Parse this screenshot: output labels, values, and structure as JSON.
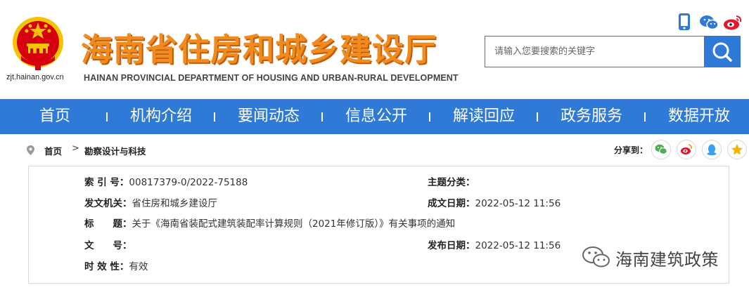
{
  "header": {
    "domain": "zjt.hainan.gov.cn",
    "title": "海南省住房和城乡建设厅",
    "subtitle": "HAINAN PROVINCIAL DEPARTMENT OF HOUSING AND URBAN-RURAL DEVELOPMENT",
    "search": {
      "placeholder": "请输入您要搜索的关键字"
    },
    "icons": [
      "mobile-icon",
      "wechat-icon",
      "weibo-icon"
    ]
  },
  "nav": {
    "items": [
      {
        "label": "首页"
      },
      {
        "label": "机构介绍"
      },
      {
        "label": "要闻动态"
      },
      {
        "label": "信息公开"
      },
      {
        "label": "解读回应"
      },
      {
        "label": "政务服务"
      },
      {
        "label": "数据开放"
      }
    ]
  },
  "breadcrumb": {
    "home": "首页",
    "separator": ">",
    "current": "勘察设计与科技",
    "share_label": "分享到：",
    "share_icons": [
      "wechat-icon",
      "weibo-icon",
      "qq-icon",
      "qzone-icon"
    ]
  },
  "info": {
    "index_label": "索 引 号：",
    "index_value": "00817379-0/2022-75188",
    "topic_label": "主题分类：",
    "topic_value": "",
    "issuer_label": "发文机关：",
    "issuer_value": "省住房和城乡建设厅",
    "created_label": "成文日期：",
    "created_value": "2022-05-12 11:56",
    "title_label": "标　　题：",
    "title_value": "关于《海南省装配式建筑装配率计算规则（2021年修订版）》有关事项的通知",
    "docno_label": "文　　号：",
    "docno_value": "",
    "published_label": "发布日期：",
    "published_value": "2022-05-12 11:56",
    "validity_label": "时 效 性：",
    "validity_value": "有效"
  },
  "watermark": {
    "text": "海南建筑政策"
  },
  "colors": {
    "brand_blue": "#2f7ad6",
    "title_orange": "#f08b1e",
    "emblem_red": "#d7000f",
    "emblem_gold": "#f5c400"
  }
}
